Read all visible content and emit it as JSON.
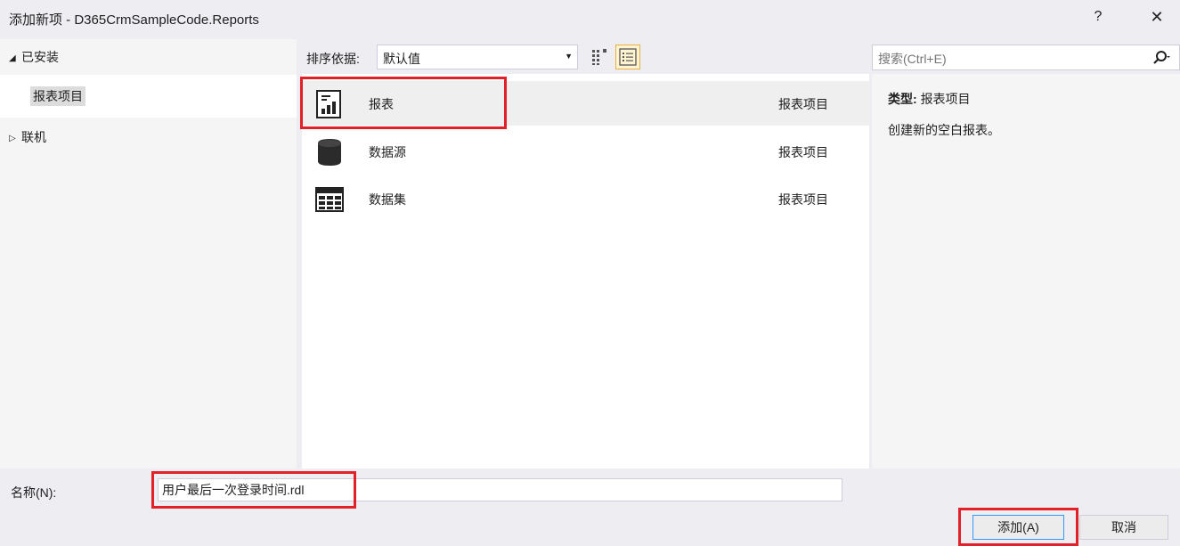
{
  "window": {
    "title": "添加新项 - D365CrmSampleCode.Reports",
    "help_label": "?",
    "close_label": "✕"
  },
  "tree": {
    "installed_label": "已安装",
    "selected_item_label": "报表项目",
    "online_label": "联机"
  },
  "toolbar": {
    "sort_label": "排序依据:",
    "sort_value": "默认值"
  },
  "items": [
    {
      "name": "报表",
      "category": "报表项目",
      "icon": "report-icon"
    },
    {
      "name": "数据源",
      "category": "报表项目",
      "icon": "datasource-icon"
    },
    {
      "name": "数据集",
      "category": "报表项目",
      "icon": "dataset-icon"
    }
  ],
  "search": {
    "placeholder": "搜索(Ctrl+E)"
  },
  "details": {
    "type_label": "类型:",
    "type_value": "报表项目",
    "description": "创建新的空白报表。"
  },
  "name_field": {
    "label": "名称(N):",
    "value": "用户最后一次登录时间.rdl"
  },
  "buttons": {
    "add_label": "添加(A)",
    "cancel_label": "取消"
  },
  "colors": {
    "highlight": "#e1202a",
    "selection_bg": "#efefef",
    "accent": "#3399ff"
  }
}
